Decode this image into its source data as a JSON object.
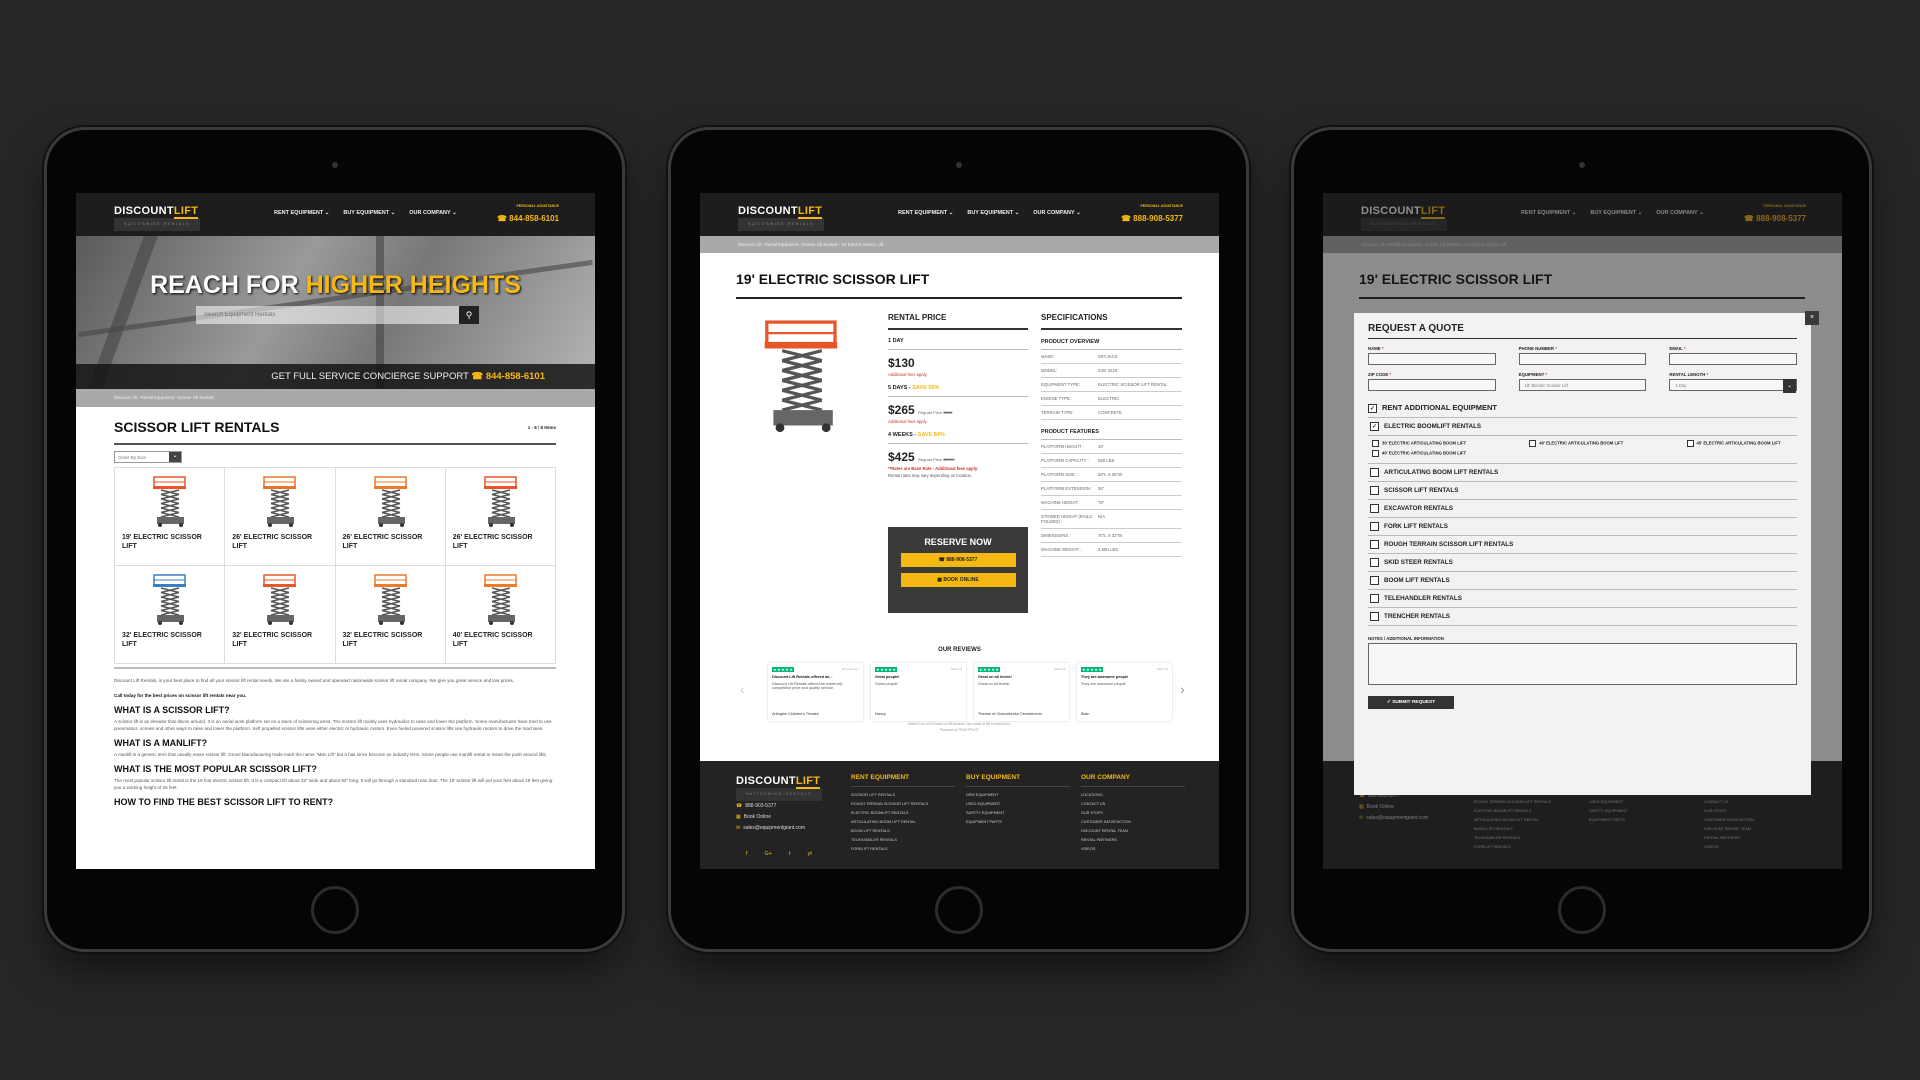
{
  "header": {
    "logo_a": "DISCOUNT",
    "logo_b": "LIFT",
    "logo_sub": "NATIONWIDE RENTALS",
    "nav": [
      "RENT EQUIPMENT",
      "BUY EQUIPMENT",
      "OUR COMPANY"
    ],
    "assist": "PERSONAL ASSISTANCE"
  },
  "colors": {
    "accent": "#f6b913",
    "dark": "#1d1d1d"
  },
  "left": {
    "phone": "844-858-6101",
    "hero_a": "REACH FOR",
    "hero_b": "HIGHER HEIGHTS",
    "search_placeholder": "Search Equipment Rentals",
    "concierge": "GET FULL SERVICE CONCIERGE SUPPORT",
    "concierge_phone": "844-858-6101",
    "breadcrumb": [
      "Discount Lift",
      "Rental Equipment",
      "Scissor Lift Rentals"
    ],
    "title": "SCISSOR LIFT RENTALS",
    "count": "1 - 8 / 8 Items",
    "sort": "Order By Size",
    "products": [
      {
        "name": "19' ELECTRIC SCISSOR LIFT",
        "color": "#e8562a"
      },
      {
        "name": "26' ELECTRIC SCISSOR LIFT",
        "color": "#e8762a"
      },
      {
        "name": "26' ELECTRIC SCISSOR LIFT",
        "color": "#ee7a2a"
      },
      {
        "name": "26' ELECTRIC SCISSOR LIFT",
        "color": "#e8562a"
      },
      {
        "name": "32' ELECTRIC SCISSOR LIFT",
        "color": "#3a7fc1"
      },
      {
        "name": "32' ELECTRIC SCISSOR LIFT",
        "color": "#e8562a"
      },
      {
        "name": "32' ELECTRIC SCISSOR LIFT",
        "color": "#ee7a2a"
      },
      {
        "name": "40' ELECTRIC SCISSOR LIFT",
        "color": "#ee7a2a"
      }
    ],
    "intro": "Discount Lift Rentals, is your best place to find all your scissor lift rental needs. We are a family owned and operated nationwide scissor lift rental company. We give you great service and low prices.",
    "cta": "Call today for the best prices on scissor lift rentals near you.",
    "sections": [
      {
        "h": "WHAT IS A SCISSOR LIFT?",
        "p": "A scissor lift is an elevator that drives around. It is an aerial work platform set on a stack of scissoring arms. The scissor lift mainly uses hydraulics to raise and lower the platform. Some manufactures have tried to use pneumatics, screws and other ways to raise and lower the platform. Self propelled scissor lifts uses either electric or hydraulic motors. Even fueled powered scissor lifts use hydraulic motors to drive the machines."
      },
      {
        "h": "WHAT IS A MANLIFT?",
        "p": "A manlift is a generic term that usually mean scissor lift. Grove Manufacturing trade mark the name \"Man Lift\" but it has since become an industry term. Some people use manlift rental to mean the push around lifts."
      },
      {
        "h": "WHAT IS THE MOST POPULAR SCISSOR LIFT?",
        "p": "The most popular scissor lift rental is the 19 foot electric scissor lift. It is a compact lift about 32\" wide and about 93\" long. It will go through a standard man door. The 19' scissor lift will put your feet about 19 feet giving you a working height of 25 feet."
      },
      {
        "h": "HOW TO FIND THE BEST SCISSOR LIFT TO RENT?",
        "p": ""
      }
    ]
  },
  "middle": {
    "phone": "888-908-5377",
    "breadcrumb": [
      "Discount Lift",
      "Rental Equipment",
      "Scissor Lift Rentals",
      "19' Electric Scissor Lift"
    ],
    "title": "19' ELECTRIC SCISSOR LIFT",
    "rental": {
      "heading": "RENTAL PRICE",
      "day_label": "1 DAY",
      "day_price": "$130",
      "fees": "Additional fees apply.",
      "week_label": "5 DAYS",
      "week_save": "SAVE 59%",
      "week_price": "$265",
      "week_reg": "Regular Price",
      "week_reg_val": "$650",
      "month_label": "4 WEEKS",
      "month_save": "SAVE 84%",
      "month_price": "$425",
      "month_reg": "Regular Price",
      "month_reg_val": "$2600",
      "base_note": "**Rates are Base Rate - Additional fees apply.",
      "vary_note": "Rental rates may vary depending on location."
    },
    "reserve": {
      "title": "RESERVE NOW",
      "phone": "888-908-5377",
      "book": "BOOK ONLINE"
    },
    "specs": {
      "heading": "SPECIFICATIONS",
      "overview_title": "PRODUCT OVERVIEW",
      "overview": [
        [
          "MAKE:",
          "SKYJACK"
        ],
        [
          "MODEL:",
          "SJIII 3219"
        ],
        [
          "EQUIPMENT TYPE:",
          "ELECTRIC SCISSOR LIFT RENTAL"
        ],
        [
          "ENGINE TYPE:",
          "ELECTRIC"
        ],
        [
          "TERRAIN TYPE:",
          "CONCRETE"
        ]
      ],
      "features_title": "PRODUCT FEATURES",
      "features": [
        [
          "PLATFORM HEIGHT :",
          "19'"
        ],
        [
          "PLATFORM CAPACITY :",
          "550 LBS"
        ],
        [
          "PLATFORM SIZE :",
          "64\"L X 26\"W"
        ],
        [
          "PLATFORM EXTENSION :",
          "36\""
        ],
        [
          "MACHINE HEIGHT :",
          "78\""
        ],
        [
          "STOWED HEIGHT (RAILS FOLDED) :",
          "N/A"
        ],
        [
          "DIMENSIONS :",
          "70\"L X 32\"W"
        ],
        [
          "MACHINE WEIGHT :",
          "2,580 LBS"
        ]
      ]
    },
    "reviews": {
      "title": "OUR REVIEWS",
      "items": [
        {
          "date": "20 hours ago",
          "title": "Discount Lift Rentals offered an...",
          "body": "Discount Lift Rentals offered an extremely competitive price and quality service.",
          "author": "Arlington Children's Theatre"
        },
        {
          "date": "March 8",
          "title": "Great people!",
          "body": "Great people!",
          "author": "Nancy"
        },
        {
          "date": "March 8",
          "title": "Great on all levels!",
          "body": "Great on all levels!",
          "author": "Theatre of Chanceburke Cemetereum"
        },
        {
          "date": "March 8",
          "title": "They are awesome people",
          "body": "They are awesome people",
          "author": "Blain"
        }
      ],
      "rating_line": "Rated 5 out of 10 based on 85 reviews. See some of the reviews here.",
      "powered": "Powered by TRUSTPILOT"
    },
    "footer": {
      "phone": "888-903-5377",
      "book": "Book Online",
      "email": "sales@equipmentgiant.com",
      "social": [
        "f",
        "G+",
        "t",
        "yt"
      ],
      "cols": [
        {
          "h": "RENT EQUIPMENT",
          "links": [
            "SCISSOR LIFT RENTALS",
            "ROUGH TERRAIN SCISSOR LIFT RENTALS",
            "ELECTRIC BOOMLIFT RENTALS",
            "ARTICULATING BOOM LIFT RENTAL",
            "BOOM LIFT RENTALS",
            "TELEHANDLER RENTALS",
            "FORKLIFT RENTALS"
          ]
        },
        {
          "h": "BUY EQUIPMENT",
          "links": [
            "NEW EQUIPMENT",
            "USED EQUIPMENT",
            "SAFETY EQUIPMENT",
            "EQUIPMENT PARTS"
          ]
        },
        {
          "h": "OUR COMPANY",
          "links": [
            "LOCATIONS",
            "CONTACT US",
            "OUR STORY",
            "CUSTOMER SATISFACTION",
            "DISCOUNT RENTAL TEAM",
            "RENTAL PARTNERS",
            "VIDEOS"
          ]
        }
      ]
    }
  },
  "right": {
    "phone": "888-908-5377",
    "quote": {
      "title": "REQUEST A QUOTE",
      "close": "×",
      "fields": [
        {
          "label": "NAME",
          "value": ""
        },
        {
          "label": "PHONE NUMBER",
          "value": ""
        },
        {
          "label": "EMAIL",
          "value": ""
        },
        {
          "label": "ZIP CODE",
          "value": ""
        },
        {
          "label": "EQUIPMENT",
          "value": "19' Electric Scissor Lift"
        },
        {
          "label": "RENTAL LENGTH",
          "value": "1 Day"
        }
      ],
      "required": "*",
      "additional": {
        "label": "RENT ADDITIONAL EQUIPMENT",
        "checked": true
      },
      "boomlift": {
        "label": "ELECTRIC BOOMLIFT RENTALS",
        "checked": true
      },
      "sub_items": [
        "30' ELECTRIC ARTICULATING BOOM LIFT",
        "40' ELECTRIC ARTICULATING BOOM LIFT",
        "45' ELECTRIC ARTICULATING BOOM LIFT",
        "40' ELECTRIC ARTICULATING BOOM LIFT"
      ],
      "categories": [
        "ARTICULATING BOOM LIFT RENTALS",
        "SCISSOR LIFT RENTALS",
        "EXCAVATOR RENTALS",
        "FORK LIFT RENTALS",
        "ROUGH TERRAIN SCISSOR LIFT RENTALS",
        "SKID STEER RENTALS",
        "BOOM LIFT RENTALS",
        "TELEHANDLER RENTALS",
        "TRENCHER RENTALS"
      ],
      "notes_label": "NOTES / ADDITIONAL INFORMATION",
      "notes_value": "",
      "submit": "SUBMIT REQUEST"
    }
  }
}
